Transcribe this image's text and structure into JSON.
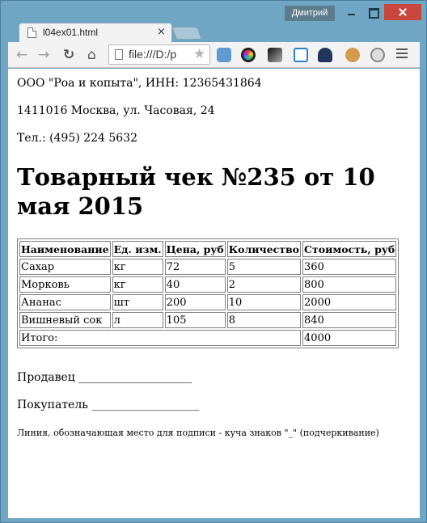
{
  "window": {
    "user_badge": "Дмитрий",
    "tab_title": "l04ex01.html",
    "tab_close": "×",
    "address_text": "file:///D:/p"
  },
  "toolbar": {
    "icons": [
      "back-icon",
      "forward-icon",
      "reload-icon",
      "home-icon",
      "page-icon",
      "star-icon",
      "camera-icon",
      "color-picker-icon",
      "grayscale-icon",
      "window-resizer-icon",
      "speedometer-icon",
      "cookie-icon",
      "power-icon",
      "menu-icon"
    ]
  },
  "page": {
    "org_line": "ООО \"Роа и копыта\", ИНН: 12365431864",
    "address_line": "1411016 Москва, ул. Часовая, 24",
    "phone_line": "Тел.: (495) 224 5632",
    "heading": "Товарный чек №235 от 10 мая 2015",
    "table": {
      "headers": [
        "Наименование",
        "Ед. изм.",
        "Цена, руб",
        "Количество",
        "Стоимость, руб"
      ],
      "rows": [
        [
          "Сахар",
          "кг",
          "72",
          "5",
          "360"
        ],
        [
          "Морковь",
          "кг",
          "40",
          "2",
          "800"
        ],
        [
          "Ананас",
          "шт",
          "200",
          "10",
          "2000"
        ],
        [
          "Вишневый сок",
          "л",
          "105",
          "8",
          "840"
        ]
      ],
      "total_label": "Итого:",
      "total_value": "4000"
    },
    "seller_line": "Продавец ____________________",
    "buyer_line": "Покупатель ___________________",
    "note_line": "Линия, обозначающая место для подписи - куча знаков \"_\" (подчеркивание)"
  },
  "colors": {
    "frame": "#6fa6c4",
    "close_button": "#c9463d",
    "user_badge": "#5c7c8d"
  }
}
